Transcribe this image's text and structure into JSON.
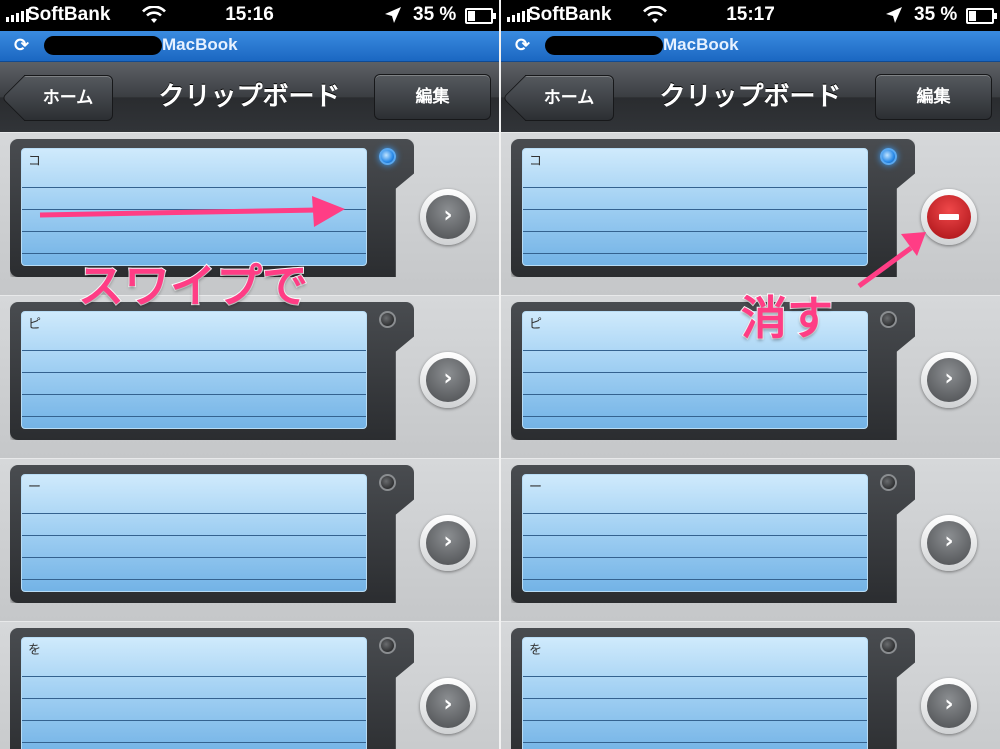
{
  "screens": [
    {
      "status": {
        "carrier": "SoftBank",
        "time": "15:16",
        "battery": "35 %"
      },
      "sync": {
        "device": "MacBook"
      },
      "nav": {
        "back": "ホーム",
        "title": "クリップボード",
        "edit": "編集"
      },
      "rows": [
        {
          "text": "コ",
          "led": "on",
          "action": "chevron-right-icon"
        },
        {
          "text": "ピ",
          "led": "off",
          "action": "chevron-right-icon"
        },
        {
          "text": "ー",
          "led": "off",
          "action": "chevron-right-icon"
        },
        {
          "text": "を",
          "led": "off",
          "action": "chevron-right-icon"
        }
      ],
      "annotation": "スワイプで"
    },
    {
      "status": {
        "carrier": "SoftBank",
        "time": "15:17",
        "battery": "35 %"
      },
      "sync": {
        "device": "MacBook"
      },
      "nav": {
        "back": "ホーム",
        "title": "クリップボード",
        "edit": "編集"
      },
      "rows": [
        {
          "text": "コ",
          "led": "on",
          "action": "delete-icon"
        },
        {
          "text": "ピ",
          "led": "off",
          "action": "chevron-right-icon"
        },
        {
          "text": "ー",
          "led": "off",
          "action": "chevron-right-icon"
        },
        {
          "text": "を",
          "led": "off",
          "action": "chevron-right-icon"
        }
      ],
      "annotation": "消す"
    }
  ],
  "colors": {
    "annotation": "#ff3d85",
    "sync_bar": "#2476d4",
    "delete": "#d3191f",
    "led_on": "#2a8ae8"
  }
}
